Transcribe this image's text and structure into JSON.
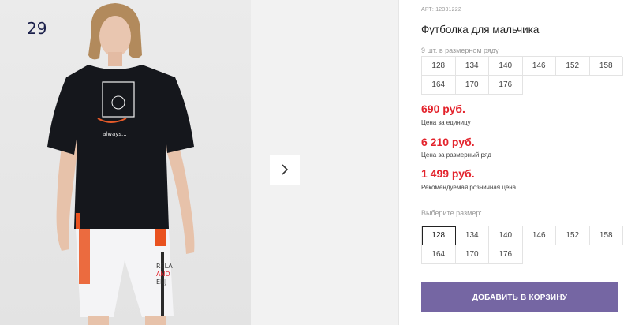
{
  "gallery": {
    "photo_index": "29",
    "next_icon": "chevron-right-icon"
  },
  "product": {
    "article": "АРТ: 12331222",
    "title": "Футболка для мальчика",
    "size_note": "9 шт. в размерном ряду",
    "size_row": [
      "128",
      "134",
      "140",
      "146",
      "152",
      "158",
      "164",
      "170",
      "176"
    ],
    "prices": [
      {
        "value": "690 руб.",
        "label": "Цена за единицу"
      },
      {
        "value": "6 210 руб.",
        "label": "Цена за размерный ряд"
      },
      {
        "value": "1 499 руб.",
        "label": "Рекомендуемая розничная цена"
      }
    ],
    "choose_size_label": "Выберите размер:",
    "size_options": [
      "128",
      "134",
      "140",
      "146",
      "152",
      "158",
      "164",
      "170",
      "176"
    ],
    "selected_size": "128",
    "add_to_cart_label": "ДОБАВИТЬ В КОРЗИНУ"
  },
  "colors": {
    "price": "#e3232c",
    "button": "#7566a3"
  }
}
